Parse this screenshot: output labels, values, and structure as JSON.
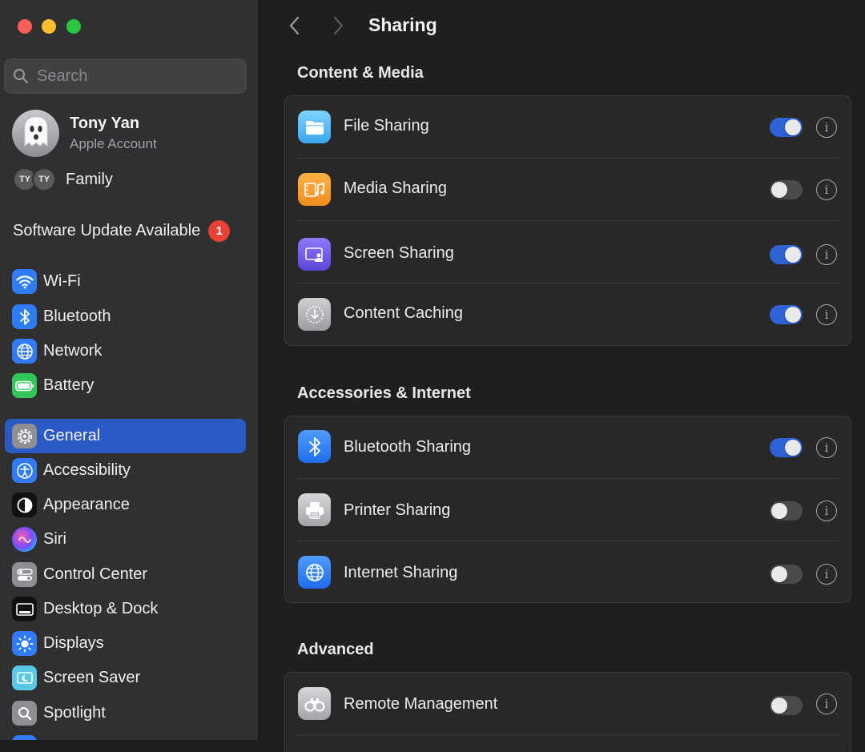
{
  "window": {
    "title": "Sharing",
    "traffic_lights": {
      "close": "#fd5f57",
      "minimize": "#febc2e",
      "zoom": "#28c840"
    }
  },
  "colors": {
    "accent": "#2e63d6",
    "selected_row": "#2c5ac4",
    "badge": "#e94235"
  },
  "sidebar": {
    "search": {
      "placeholder": "Search",
      "value": ""
    },
    "account": {
      "name": "Tony Yan",
      "subtitle": "Apple Account",
      "avatar_icon": "ghost-icon"
    },
    "family": {
      "initials": [
        "TY",
        "TY"
      ],
      "label": "Family"
    },
    "software_update": {
      "label": "Software Update Available",
      "badge_count": "1"
    },
    "items": [
      {
        "label": "Wi-Fi",
        "icon": "wifi-icon",
        "selected": false
      },
      {
        "label": "Bluetooth",
        "icon": "bluetooth-icon",
        "selected": false
      },
      {
        "label": "Network",
        "icon": "globe-icon",
        "selected": false
      },
      {
        "label": "Battery",
        "icon": "battery-icon",
        "selected": false
      },
      {
        "label": "General",
        "icon": "gear-icon",
        "selected": true
      },
      {
        "label": "Accessibility",
        "icon": "accessibility-icon",
        "selected": false
      },
      {
        "label": "Appearance",
        "icon": "appearance-icon",
        "selected": false
      },
      {
        "label": "Siri",
        "icon": "siri-icon",
        "selected": false
      },
      {
        "label": "Control Center",
        "icon": "control-center-icon",
        "selected": false
      },
      {
        "label": "Desktop & Dock",
        "icon": "dock-icon",
        "selected": false
      },
      {
        "label": "Displays",
        "icon": "sun-icon",
        "selected": false
      },
      {
        "label": "Screen Saver",
        "icon": "screen-saver-icon",
        "selected": false
      },
      {
        "label": "Spotlight",
        "icon": "magnifier-icon",
        "selected": false
      }
    ]
  },
  "main": {
    "title": "Sharing",
    "sections": [
      {
        "title": "Content & Media",
        "rows": [
          {
            "label": "File Sharing",
            "icon": "folder-icon",
            "enabled": true
          },
          {
            "label": "Media Sharing",
            "icon": "music-film-icon",
            "enabled": false
          },
          {
            "label": "Screen Sharing",
            "icon": "screen-sharing-icon",
            "enabled": true
          },
          {
            "label": "Content Caching",
            "icon": "download-icon",
            "enabled": true
          }
        ]
      },
      {
        "title": "Accessories & Internet",
        "rows": [
          {
            "label": "Bluetooth Sharing",
            "icon": "bluetooth-icon",
            "enabled": true
          },
          {
            "label": "Printer Sharing",
            "icon": "printer-icon",
            "enabled": false
          },
          {
            "label": "Internet Sharing",
            "icon": "globe-icon",
            "enabled": false
          }
        ]
      },
      {
        "title": "Advanced",
        "rows": [
          {
            "label": "Remote Management",
            "icon": "binoculars-icon",
            "enabled": false
          }
        ]
      }
    ]
  }
}
